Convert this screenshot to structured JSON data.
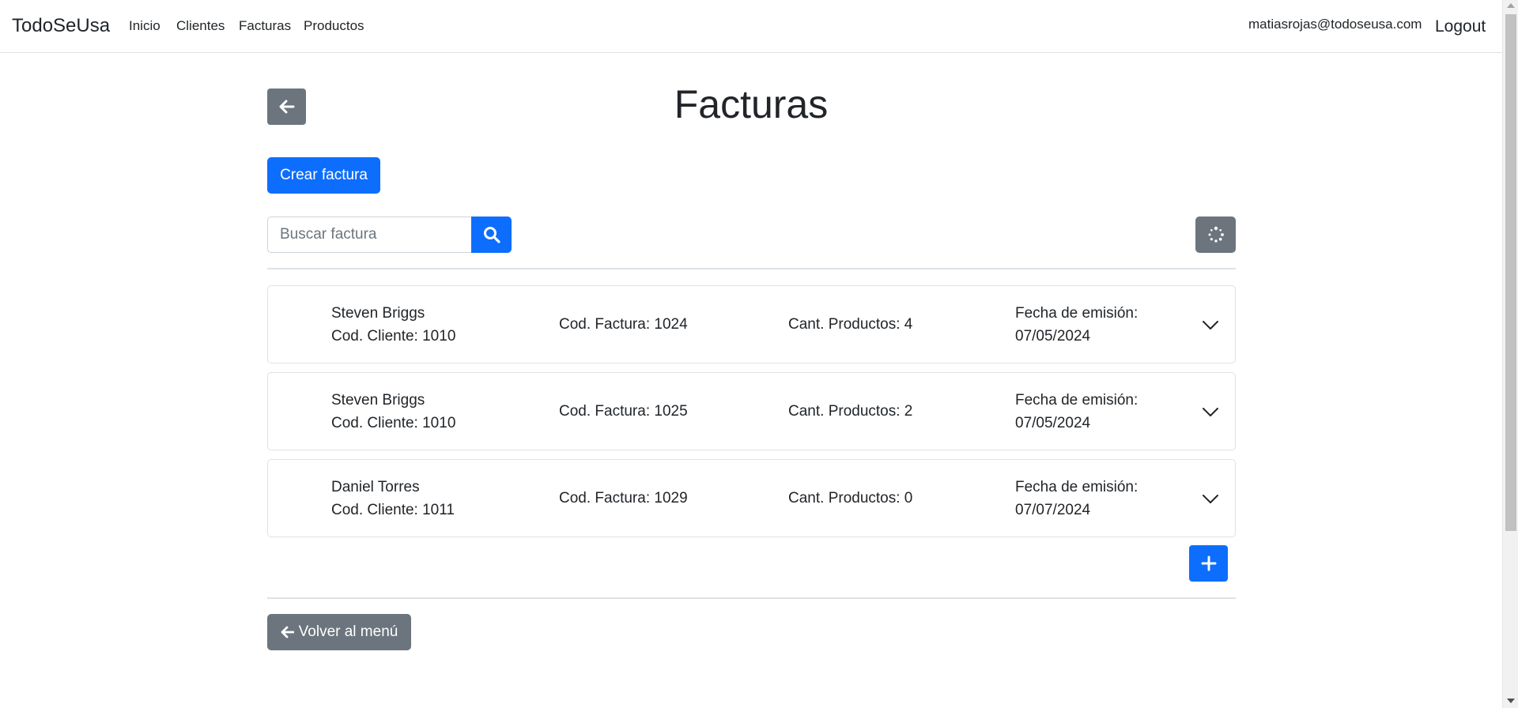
{
  "navbar": {
    "brand": "TodoSeUsa",
    "links": [
      "Inicio",
      "Clientes",
      "Facturas",
      "Productos"
    ],
    "user_email": "matiasrojas@todoseusa.com",
    "logout_label": "Logout"
  },
  "page": {
    "title": "Facturas",
    "create_label": "Crear factura",
    "back_menu_label": "Volver al menú"
  },
  "search": {
    "placeholder": "Buscar factura",
    "value": ""
  },
  "invoices": [
    {
      "client_name": "Steven Briggs",
      "client_code": "Cod. Cliente: 1010",
      "invoice_code": "Cod. Factura: 1024",
      "product_count": "Cant. Productos: 4",
      "date_label": "Fecha de emisión:",
      "date": "07/05/2024"
    },
    {
      "client_name": "Steven Briggs",
      "client_code": "Cod. Cliente: 1010",
      "invoice_code": "Cod. Factura: 1025",
      "product_count": "Cant. Productos: 2",
      "date_label": "Fecha de emisión:",
      "date": "07/05/2024"
    },
    {
      "client_name": "Daniel Torres",
      "client_code": "Cod. Cliente: 1011",
      "invoice_code": "Cod. Factura: 1029",
      "product_count": "Cant. Productos: 0",
      "date_label": "Fecha de emisión:",
      "date": "07/07/2024"
    }
  ],
  "icons": {
    "back": "arrow-left-icon",
    "search": "search-icon",
    "refresh": "spinner-icon",
    "expand": "chevron-down-icon",
    "add": "plus-icon"
  },
  "colors": {
    "primary": "#0d6efd",
    "secondary": "#6c757d",
    "border": "#dee2e6",
    "text": "#212529"
  }
}
